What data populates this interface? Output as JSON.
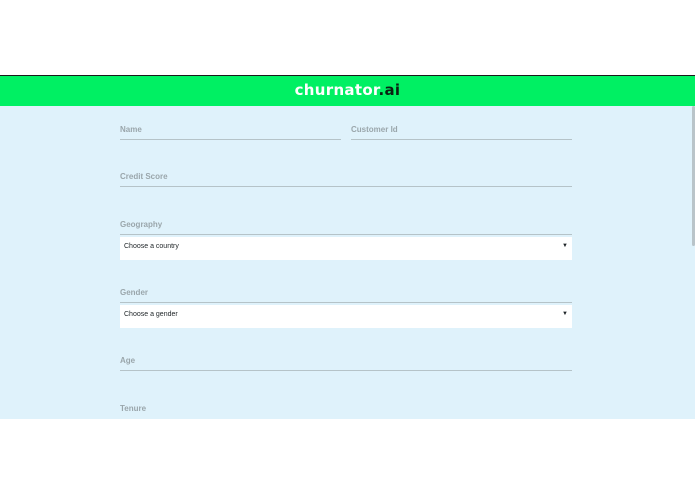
{
  "header": {
    "brand_main": "churnator",
    "brand_tld": ".ai"
  },
  "form": {
    "name_label": "Name",
    "customer_id_label": "Customer Id",
    "credit_score_label": "Credit Score",
    "geography_label": "Geography",
    "geography_selected": "Choose a country",
    "gender_label": "Gender",
    "gender_selected": "Choose a gender",
    "age_label": "Age",
    "tenure_label": "Tenure"
  },
  "icons": {
    "dropdown": "caret-down-icon"
  },
  "colors": {
    "header_bg": "#00f063",
    "page_bg": "#dff2fb"
  }
}
